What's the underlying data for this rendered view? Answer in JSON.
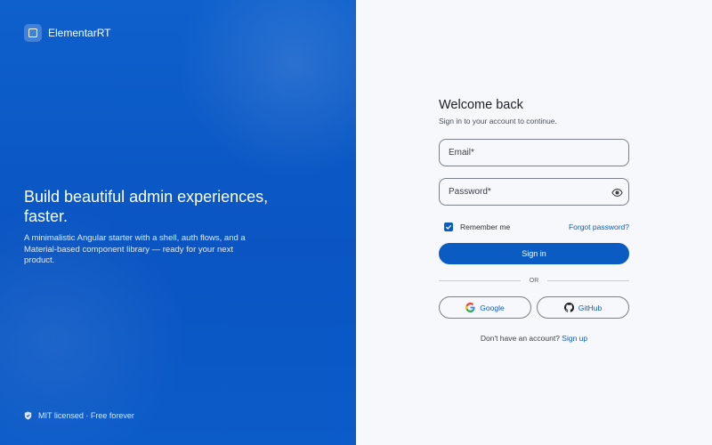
{
  "brand": {
    "name": "ElementarRT",
    "icon": "app-logo-icon"
  },
  "hero": {
    "title": "Build beautiful admin experiences, faster.",
    "description": "A minimalistic Angular starter with a shell, auth flows, and a Material-based component library — ready for your next product."
  },
  "footer": {
    "note": "MIT licensed · Free forever",
    "icon": "shield-icon"
  },
  "login": {
    "title": "Welcome back",
    "subtitle": "Sign in to your account to continue.",
    "email_label": "Email*",
    "password_label": "Password*",
    "password_toggle_icon": "eye-icon",
    "remember_label": "Remember me",
    "remember_checked": true,
    "forgot_label": "Forgot password?",
    "signin_label": "Sign in",
    "divider_label": "OR",
    "google_label": "Google",
    "github_label": "GitHub",
    "signup_prompt": "Don't have an account?",
    "signup_link": "Sign up"
  },
  "colors": {
    "primary": "#0b5cc2",
    "left_panel": "#0e60cc",
    "background": "#f7f8fc"
  }
}
